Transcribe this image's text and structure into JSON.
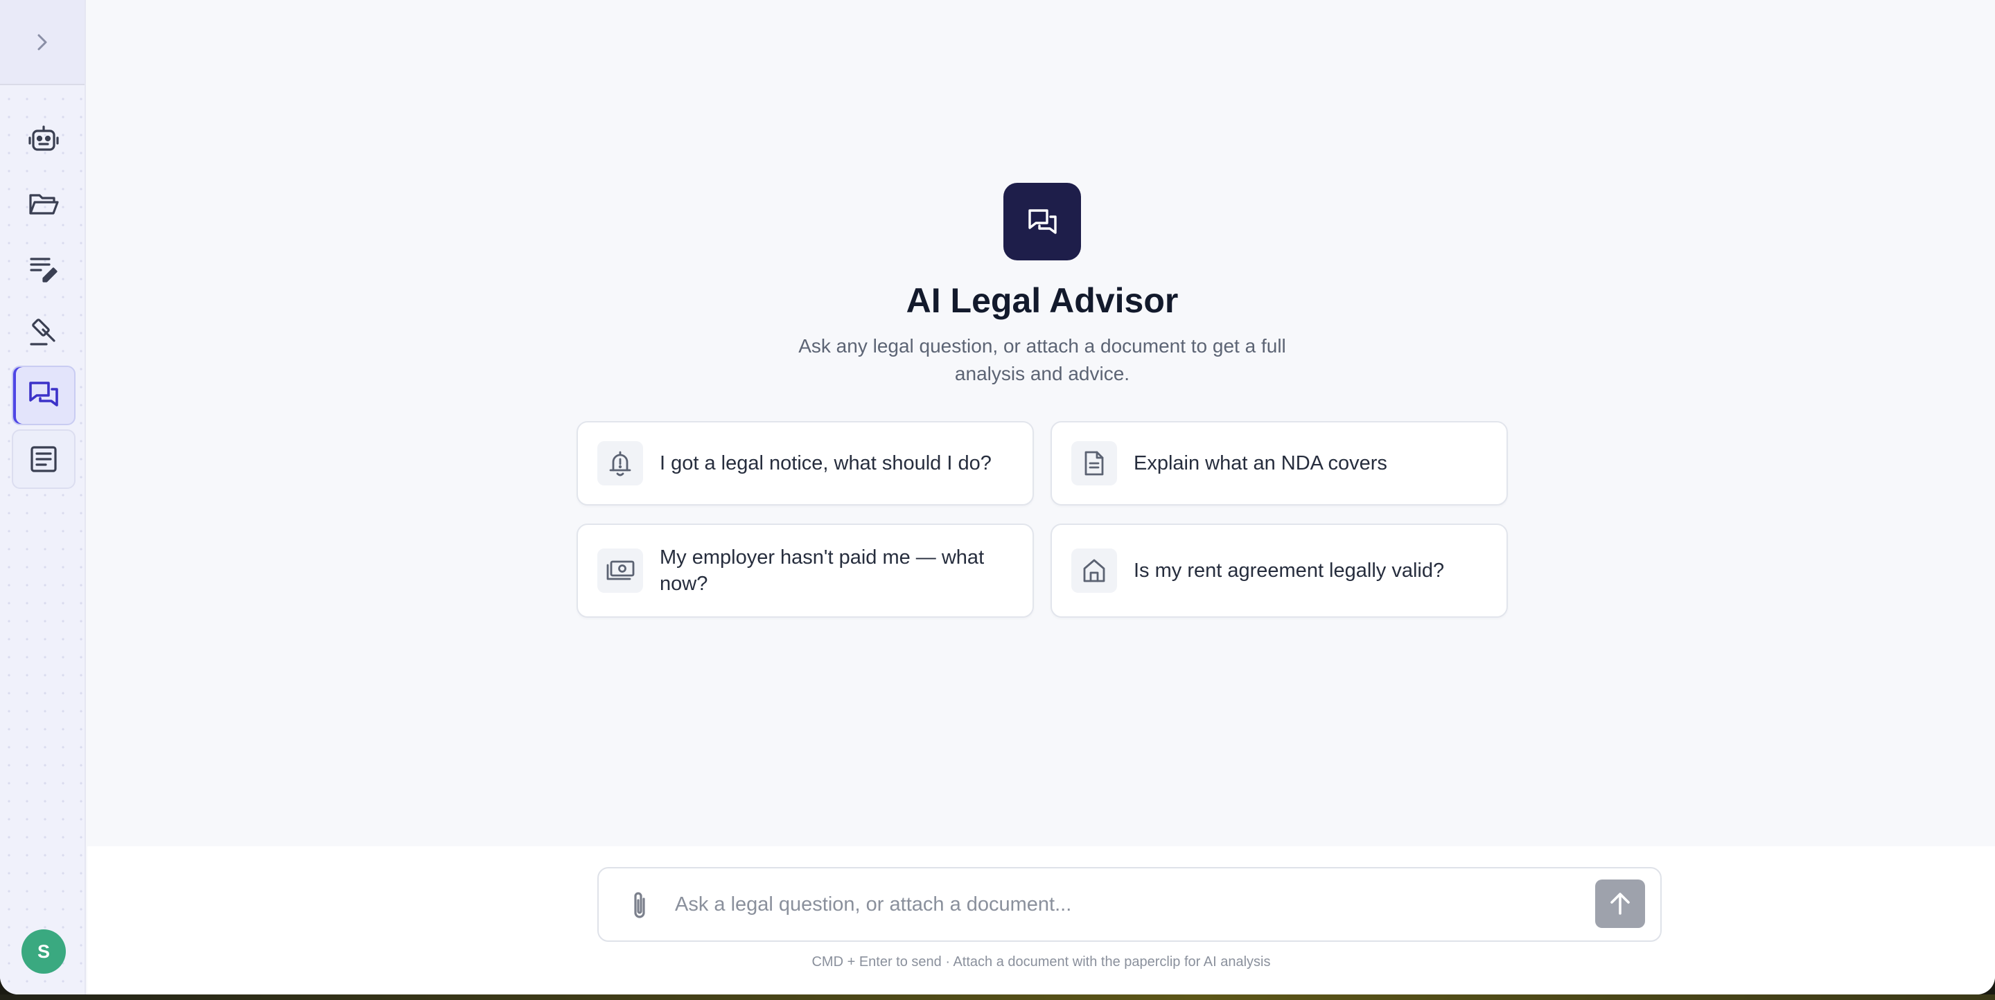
{
  "app": {
    "title": "AI Legal Advisor"
  },
  "sidebar": {
    "toggle_icon": "chevron-right-icon",
    "items": [
      {
        "id": "agents",
        "icon": "robot-icon",
        "active": false
      },
      {
        "id": "documents",
        "icon": "folder-open-icon",
        "active": false
      },
      {
        "id": "drafting",
        "icon": "list-edit-icon",
        "active": false
      },
      {
        "id": "legal",
        "icon": "gavel-icon",
        "active": false
      },
      {
        "id": "advisor",
        "icon": "chat-bubbles-icon",
        "active": true
      },
      {
        "id": "notes",
        "icon": "article-icon",
        "active": false
      }
    ],
    "user_initial": "S"
  },
  "hero": {
    "title": "AI Legal Advisor",
    "subtitle": "Ask any legal question, or attach a document to get a full analysis and advice."
  },
  "suggestions": [
    {
      "label": "I got a legal notice, what should I do?",
      "icon": "bell-alert-icon"
    },
    {
      "label": "Explain what an NDA covers",
      "icon": "document-icon"
    },
    {
      "label": "My employer hasn't paid me — what now?",
      "icon": "money-icon"
    },
    {
      "label": "Is my rent agreement legally valid?",
      "icon": "home-icon"
    }
  ],
  "composer": {
    "placeholder": "Ask a legal question, or attach a document...",
    "value": "",
    "hint": "CMD + Enter to send · Attach a document with the paperclip for AI analysis"
  },
  "colors": {
    "accent": "#4f46e5",
    "brand_dark": "#1e1e4a",
    "avatar": "#3aa980",
    "send_disabled": "#9ea2ac"
  }
}
